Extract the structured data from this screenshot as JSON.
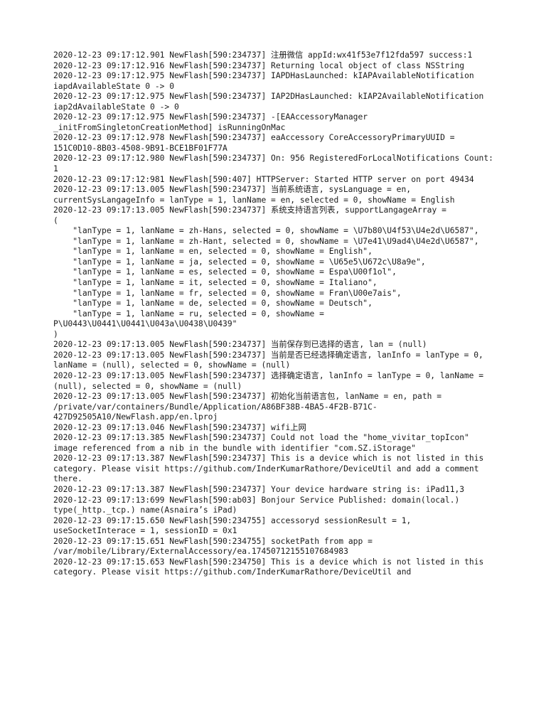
{
  "document": {
    "type": "console-log",
    "process_name": "NewFlash",
    "date": "2020-12-23",
    "text_color": "#1b1b1b",
    "background_color": "#ffffff",
    "lines": [
      "2020-12-23 09:17:12.901 NewFlash[590:234737] 注册微信 appId:wx41f53e7f12fda597 success:1",
      "2020-12-23 09:17:12.916 NewFlash[590:234737] Returning local object of class NSString",
      "2020-12-23 09:17:12.975 NewFlash[590:234737] IAPDHasLaunched: kIAPAvailableNotification iapdAvailableState 0 -> 0",
      "2020-12-23 09:17:12.975 NewFlash[590:234737] IAP2DHasLaunched: kIAP2AvailableNotification iap2dAvailableState 0 -> 0",
      "2020-12-23 09:17:12.975 NewFlash[590:234737] -[EAAccessoryManager _initFromSingletonCreationMethod] isRunningOnMac",
      "2020-12-23 09:17:12.978 NewFlash[590:234737] eaAccessory CoreAccessoryPrimaryUUID = 151C0D10-8B03-4508-9B91-BCE1BF01F77A",
      "2020-12-23 09:17:12.980 NewFlash[590:234737] On: 956 RegisteredForLocalNotifications Count: 1",
      "2020-12-23 09:17:12:981 NewFlash[590:407] HTTPServer: Started HTTP server on port 49434",
      "2020-12-23 09:17:13.005 NewFlash[590:234737] 当前系统语言, sysLanguage = en, currentSysLangageInfo = lanType = 1, lanName = en, selected = 0, showName = English",
      "2020-12-23 09:17:13.005 NewFlash[590:234737] 系统支持语言列表, supportLangageArray =",
      "(",
      "    \"lanType = 1, lanName = zh-Hans, selected = 0, showName = \\U7b80\\U4f53\\U4e2d\\U6587\",",
      "    \"lanType = 1, lanName = zh-Hant, selected = 0, showName = \\U7e41\\U9ad4\\U4e2d\\U6587\",",
      "    \"lanType = 1, lanName = en, selected = 0, showName = English\",",
      "    \"lanType = 1, lanName = ja, selected = 0, showName = \\U65e5\\U672c\\U8a9e\",",
      "    \"lanType = 1, lanName = es, selected = 0, showName = Espa\\U00f1ol\",",
      "    \"lanType = 1, lanName = it, selected = 0, showName = Italiano\",",
      "    \"lanType = 1, lanName = fr, selected = 0, showName = Fran\\U00e7ais\",",
      "    \"lanType = 1, lanName = de, selected = 0, showName = Deutsch\",",
      "    \"lanType = 1, lanName = ru, selected = 0, showName = P\\U0443\\U0441\\U0441\\U043a\\U0438\\U0439\"",
      ")",
      "2020-12-23 09:17:13.005 NewFlash[590:234737] 当前保存到已选择的语言, lan = (null)",
      "2020-12-23 09:17:13.005 NewFlash[590:234737] 当前是否已经选择确定语言, lanInfo = lanType = 0, lanName = (null), selected = 0, showName = (null)",
      "2020-12-23 09:17:13.005 NewFlash[590:234737] 选择确定语言, lanInfo = lanType = 0, lanName = (null), selected = 0, showName = (null)",
      "2020-12-23 09:17:13.005 NewFlash[590:234737] 初始化当前语言包, lanName = en, path = /private/var/containers/Bundle/Application/A86BF38B-4BA5-4F2B-B71C-427D92505A10/NewFlash.app/en.lproj",
      "2020-12-23 09:17:13.046 NewFlash[590:234737] wifi上网",
      "2020-12-23 09:17:13.385 NewFlash[590:234737] Could not load the \"home_vivitar_topIcon\" image referenced from a nib in the bundle with identifier \"com.SZ.iStorage\"",
      "2020-12-23 09:17:13.387 NewFlash[590:234737] This is a device which is not listed in this category. Please visit https://github.com/InderKumarRathore/DeviceUtil and add a comment there.",
      "2020-12-23 09:17:13.387 NewFlash[590:234737] Your device hardware string is: iPad11,3",
      "2020-12-23 09:17:13:699 NewFlash[590:ab03] Bonjour Service Published: domain(local.) type(_http._tcp.) name(Asnaira’s iPad)",
      "2020-12-23 09:17:15.650 NewFlash[590:234755] accessoryd sessionResult = 1, useSocketInterace = 1, sessionID = 0x1",
      "2020-12-23 09:17:15.651 NewFlash[590:234755] socketPath from app = /var/mobile/Library/ExternalAccessory/ea.17450712155107684983",
      "2020-12-23 09:17:15.653 NewFlash[590:234750] This is a device which is not listed in this category. Please visit https://github.com/InderKumarRathore/DeviceUtil and"
    ]
  }
}
